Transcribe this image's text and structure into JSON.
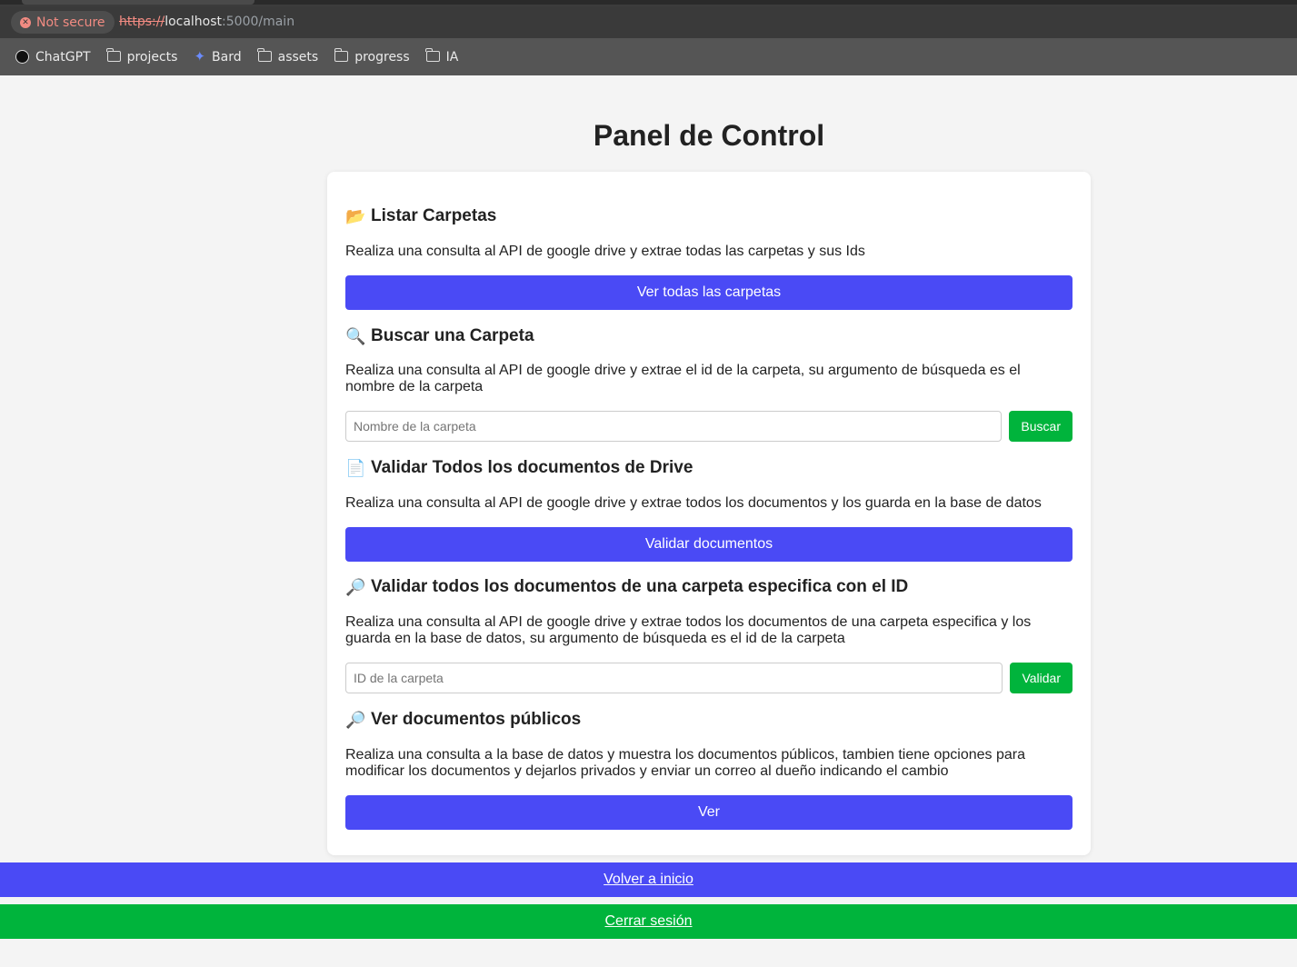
{
  "browser": {
    "security_label": "Not secure",
    "url_scheme": "https://",
    "url_host": "localhost",
    "url_rest": ":5000/main",
    "bookmarks": [
      {
        "label": "ChatGPT",
        "icon": "chatgpt-icon"
      },
      {
        "label": "projects",
        "icon": "folder-icon"
      },
      {
        "label": "Bard",
        "icon": "bard-icon"
      },
      {
        "label": "assets",
        "icon": "folder-icon"
      },
      {
        "label": "progress",
        "icon": "folder-icon"
      },
      {
        "label": "IA",
        "icon": "folder-icon"
      }
    ]
  },
  "page": {
    "title": "Panel de Control"
  },
  "sections": {
    "list_folders": {
      "emoji": "📂",
      "title": "Listar Carpetas",
      "description": "Realiza una consulta al API de google drive y extrae todas las carpetas y sus Ids",
      "button_label": "Ver todas las carpetas"
    },
    "search_folder": {
      "emoji": "🔍",
      "title": "Buscar una Carpeta",
      "description": "Realiza una consulta al API de google drive y extrae el id de la carpeta, su argumento de búsqueda es el nombre de la carpeta",
      "input_placeholder": "Nombre de la carpeta",
      "input_value": "",
      "button_label": "Buscar"
    },
    "validate_all": {
      "emoji": "📄",
      "title": "Validar Todos los documentos de Drive",
      "description": "Realiza una consulta al API de google drive y extrae todos los documentos y los guarda en la base de datos",
      "button_label": "Validar documentos"
    },
    "validate_folder": {
      "emoji": "🔎",
      "title": "Validar todos los documentos de una carpeta especifica con el ID",
      "description": "Realiza una consulta al API de google drive y extrae todos los documentos de una carpeta especifica y los guarda en la base de datos, su argumento de búsqueda es el id de la carpeta",
      "input_placeholder": "ID de la carpeta",
      "input_value": "",
      "button_label": "Validar"
    },
    "public_docs": {
      "emoji": "🔎",
      "title": "Ver documentos públicos",
      "description": "Realiza una consulta a la base de datos y muestra los documentos públicos, tambien tiene opciones para modificar los documentos y dejarlos privados y enviar un correo al dueño indicando el cambio",
      "button_label": "Ver"
    }
  },
  "footer": {
    "home_label": "Volver a inicio",
    "logout_label": "Cerrar sesión"
  },
  "colors": {
    "primary_blue": "#4a4af5",
    "success_green": "#00b43c",
    "not_secure_red": "#f28b82"
  }
}
